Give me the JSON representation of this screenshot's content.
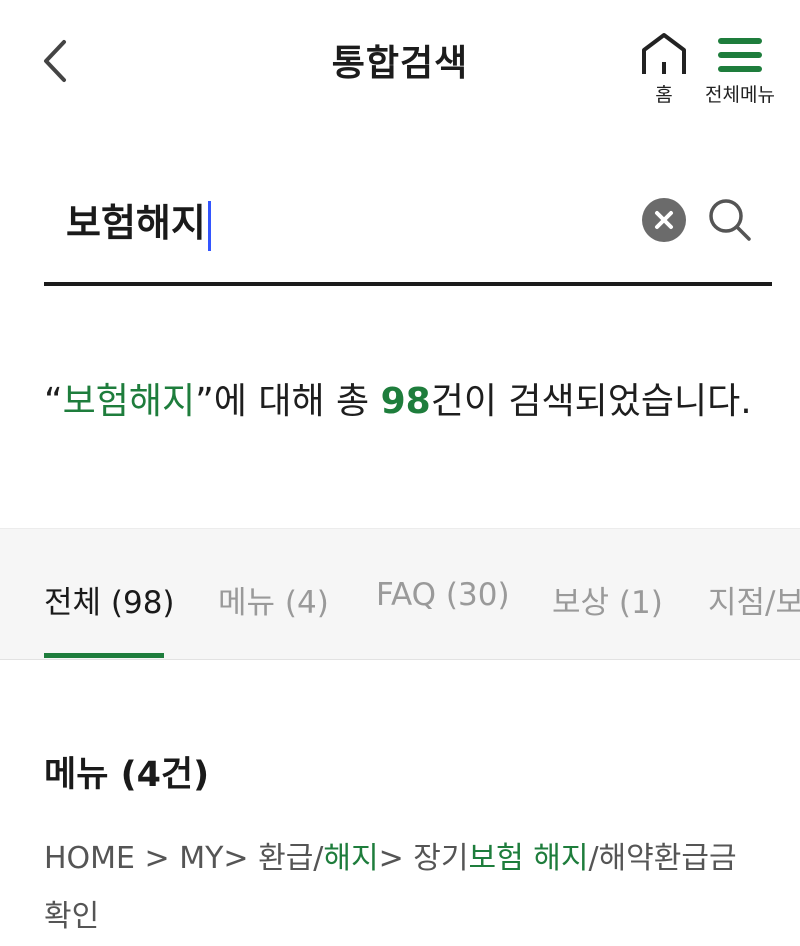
{
  "header": {
    "title": "통합검색",
    "home_label": "홈",
    "menu_label": "전체메뉴",
    "accent_color": "#1e7d3c"
  },
  "search": {
    "value": "보험해지"
  },
  "summary": {
    "open_quote": "“",
    "keyword": "보험해지",
    "mid_text": "”에 대해 총 ",
    "count": "98",
    "tail_text": "건이 검색되었습니다."
  },
  "tabs": [
    {
      "label": "전체 (98)",
      "active": true
    },
    {
      "label": "메뉴 (4)",
      "active": false
    },
    {
      "label": "FAQ (30)",
      "active": false
    },
    {
      "label": "보상 (1)",
      "active": false
    },
    {
      "label": "지점/보",
      "active": false
    }
  ],
  "menu_section": {
    "title": "메뉴 (4건)",
    "result": {
      "p1": "HOME > MY> 환급/",
      "p2": "해지",
      "p3": "> 장기",
      "p4": "보험 해지",
      "p5": "/해약환급금",
      "p6": "확인"
    }
  },
  "icons": {
    "back": "chevron-left-icon",
    "home": "home-icon",
    "menu": "hamburger-menu-icon",
    "clear": "clear-icon",
    "search": "search-icon"
  }
}
